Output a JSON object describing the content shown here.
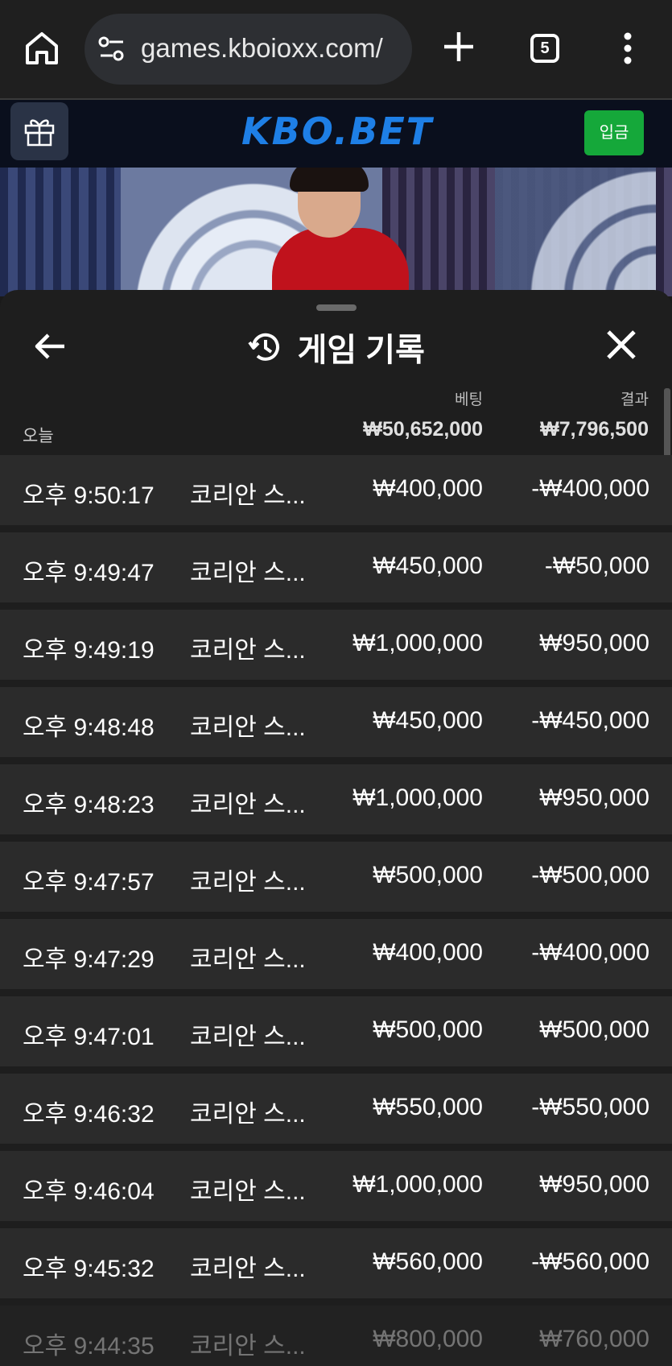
{
  "browser": {
    "url": "games.kboioxx.com/",
    "tab_count": "5"
  },
  "site": {
    "logo": "KBO.BET",
    "deposit_label": "입금"
  },
  "sheet": {
    "title": "게임 기록",
    "summary": {
      "today_label": "오늘",
      "bet_label": "베팅",
      "result_label": "결과",
      "bet_total": "₩50,652,000",
      "result_total": "₩7,796,500"
    },
    "rows": [
      {
        "time": "오후 9:50:17",
        "game": "코리안 스...",
        "bet": "₩400,000",
        "result": "-₩400,000"
      },
      {
        "time": "오후 9:49:47",
        "game": "코리안 스...",
        "bet": "₩450,000",
        "result": "-₩50,000"
      },
      {
        "time": "오후 9:49:19",
        "game": "코리안 스...",
        "bet": "₩1,000,000",
        "result": "₩950,000"
      },
      {
        "time": "오후 9:48:48",
        "game": "코리안 스...",
        "bet": "₩450,000",
        "result": "-₩450,000"
      },
      {
        "time": "오후 9:48:23",
        "game": "코리안 스...",
        "bet": "₩1,000,000",
        "result": "₩950,000"
      },
      {
        "time": "오후 9:47:57",
        "game": "코리안 스...",
        "bet": "₩500,000",
        "result": "-₩500,000"
      },
      {
        "time": "오후 9:47:29",
        "game": "코리안 스...",
        "bet": "₩400,000",
        "result": "-₩400,000"
      },
      {
        "time": "오후 9:47:01",
        "game": "코리안 스...",
        "bet": "₩500,000",
        "result": "₩500,000"
      },
      {
        "time": "오후 9:46:32",
        "game": "코리안 스...",
        "bet": "₩550,000",
        "result": "-₩550,000"
      },
      {
        "time": "오후 9:46:04",
        "game": "코리안 스...",
        "bet": "₩1,000,000",
        "result": "₩950,000"
      },
      {
        "time": "오후 9:45:32",
        "game": "코리안 스...",
        "bet": "₩560,000",
        "result": "-₩560,000"
      },
      {
        "time": "오후 9:44:35",
        "game": "코리안 스...",
        "bet": "₩800,000",
        "result": "₩760,000"
      }
    ]
  },
  "colors": {
    "logo": "#1e7fe6",
    "deposit_button": "#15a83a",
    "row_background": "#2b2b2b",
    "sheet_background": "#1e1e1e"
  },
  "icons": [
    "home-icon",
    "site-info-icon",
    "plus-icon",
    "tabs-icon",
    "more-vert-icon",
    "gift-icon",
    "back-arrow-icon",
    "history-icon",
    "close-icon"
  ]
}
